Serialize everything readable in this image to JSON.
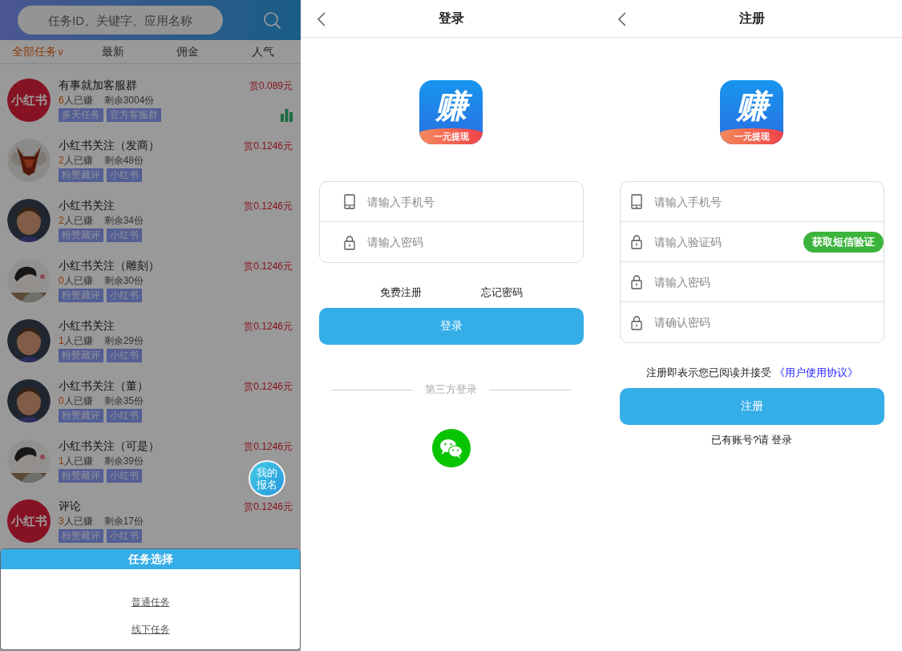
{
  "task_list": {
    "dimmed": true,
    "search": {
      "placeholder": "任务ID、关键字、应用名称"
    },
    "tabs": [
      {
        "label": "全部任务",
        "caret": "v",
        "selected": true
      },
      {
        "label": "最新",
        "selected": false
      },
      {
        "label": "佣金",
        "selected": false
      },
      {
        "label": "人气",
        "selected": false
      }
    ],
    "tasks": [
      {
        "avatar": {
          "kind": "brand",
          "text": "小红书"
        },
        "title": "有事就加客服群",
        "earned_count": "6",
        "earned_label": "人已赚",
        "remaining": "剩余3004份",
        "reward": "赏0.089元",
        "tags": [
          "多天任务",
          "官方客服群"
        ],
        "chart_icon": true
      },
      {
        "avatar": {
          "kind": "bull"
        },
        "title": "小红书关注（发商）",
        "earned_count": "2",
        "earned_label": "人已赚",
        "remaining": "剩余48份",
        "reward": "赏0.1246元",
        "tags": [
          "粉赞藏评",
          "小红书"
        ],
        "chart_icon": false
      },
      {
        "avatar": {
          "kind": "boy"
        },
        "title": "小红书关注",
        "earned_count": "2",
        "earned_label": "人已赚",
        "remaining": "剩余34份",
        "reward": "赏0.1246元",
        "tags": [
          "粉赞藏评",
          "小红书"
        ],
        "chart_icon": false
      },
      {
        "avatar": {
          "kind": "sketch"
        },
        "title": "小红书关注（雕刻）",
        "earned_count": "0",
        "earned_label": "人已赚",
        "remaining": "剩余30份",
        "reward": "赏0.1246元",
        "tags": [
          "粉赞藏评",
          "小红书"
        ],
        "chart_icon": false
      },
      {
        "avatar": {
          "kind": "boy"
        },
        "title": "小红书关注",
        "earned_count": "1",
        "earned_label": "人已赚",
        "remaining": "剩余29份",
        "reward": "赏0.1246元",
        "tags": [
          "粉赞藏评",
          "小红书"
        ],
        "chart_icon": false
      },
      {
        "avatar": {
          "kind": "boy"
        },
        "title": "小红书关注（董）",
        "earned_count": "0",
        "earned_label": "人已赚",
        "remaining": "剩余35份",
        "reward": "赏0.1246元",
        "tags": [
          "粉赞藏评",
          "小红书"
        ],
        "chart_icon": false
      },
      {
        "avatar": {
          "kind": "sketch"
        },
        "title": "小红书关注（可是）",
        "earned_count": "1",
        "earned_label": "人已赚",
        "remaining": "剩余39份",
        "reward": "赏0.1246元",
        "tags": [
          "粉赞藏评",
          "小红书"
        ],
        "chart_icon": false
      },
      {
        "avatar": {
          "kind": "brand",
          "text": "小红书"
        },
        "title": "评论",
        "earned_count": "3",
        "earned_label": "人已赚",
        "remaining": "剩余17份",
        "reward": "赏0.1246元",
        "tags": [
          "粉赞藏评",
          "小红书"
        ],
        "chart_icon": false
      }
    ],
    "floating_button": {
      "lines": [
        "我的",
        "报名"
      ]
    },
    "task_picker": {
      "title": "任务选择",
      "options": [
        "普通任务",
        "线下任务"
      ]
    }
  },
  "login": {
    "title": "登录",
    "logo": {
      "glyph": "赚",
      "banner": "一元提现"
    },
    "fields": [
      {
        "kind": "phone",
        "placeholder": "请输入手机号"
      },
      {
        "kind": "password",
        "placeholder": "请输入密码"
      }
    ],
    "links": [
      "免费注册",
      "忘记密码"
    ],
    "submit": "登录",
    "divider_text": "第三方登录",
    "social": [
      {
        "kind": "wechat"
      }
    ]
  },
  "register": {
    "title": "注册",
    "logo": {
      "glyph": "赚",
      "banner": "一元提现"
    },
    "fields": [
      {
        "kind": "phone",
        "placeholder": "请输入手机号"
      },
      {
        "kind": "code",
        "placeholder": "请输入验证码",
        "action": "获取短信验证"
      },
      {
        "kind": "password",
        "placeholder": "请输入密码"
      },
      {
        "kind": "password",
        "placeholder": "请确认密码"
      }
    ],
    "agreement": {
      "text": "注册即表示您已阅读并接受",
      "link": "《用户使用协议》"
    },
    "submit": "注册",
    "login_prompt": {
      "text": "已有账号?请",
      "link": "登录"
    }
  }
}
